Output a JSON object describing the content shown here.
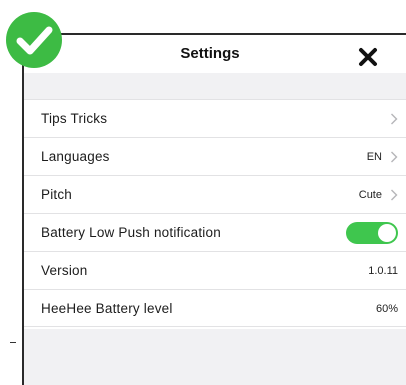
{
  "header": {
    "title": "Settings"
  },
  "colors": {
    "accent_green": "#3fc64e",
    "badge_green": "#3dbb44",
    "separator": "#e2e2e4",
    "section_gap": "#f1f1f3"
  },
  "icons": {
    "badge": "checkmark-icon",
    "close": "close-icon",
    "chevron": "chevron-right-icon"
  },
  "rows": [
    {
      "label": "Tips Tricks",
      "value": "",
      "control": "chevron"
    },
    {
      "label": "Languages",
      "value": "EN",
      "control": "chevron"
    },
    {
      "label": "Pitch",
      "value": "Cute",
      "control": "chevron"
    },
    {
      "label": "Battery Low Push notification",
      "value": "",
      "control": "toggle",
      "toggle_on": true
    },
    {
      "label": "Version",
      "value": "1.0.11",
      "control": "none"
    },
    {
      "label": "HeeHee Battery level",
      "value": "60%",
      "control": "none"
    }
  ]
}
